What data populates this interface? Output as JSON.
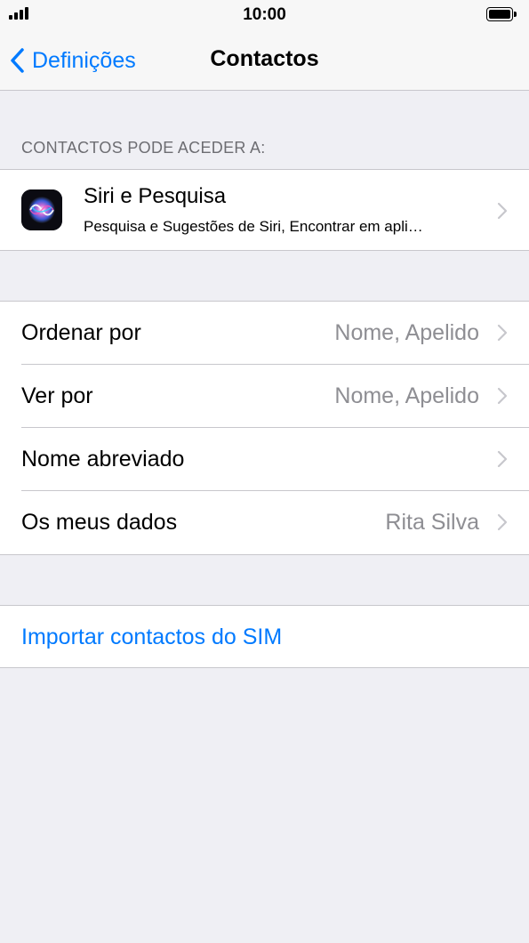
{
  "status_bar": {
    "time": "10:00"
  },
  "nav": {
    "back_label": "Definições",
    "title": "Contactos"
  },
  "section_header": "CONTACTOS PODE ACEDER A:",
  "siri": {
    "title": "Siri e Pesquisa",
    "subtitle": "Pesquisa e Sugestões de Siri, Encontrar em apli…",
    "icon": "siri-icon"
  },
  "settings_rows": [
    {
      "label": "Ordenar por",
      "value": "Nome, Apelido"
    },
    {
      "label": "Ver por",
      "value": "Nome, Apelido"
    },
    {
      "label": "Nome abreviado",
      "value": ""
    },
    {
      "label": "Os meus dados",
      "value": "Rita Silva"
    }
  ],
  "import_link": "Importar contactos do SIM",
  "colors": {
    "accent": "#007aff",
    "background": "#efeff4",
    "secondary_text": "#8e8e93",
    "separator": "#c8c7cc"
  }
}
